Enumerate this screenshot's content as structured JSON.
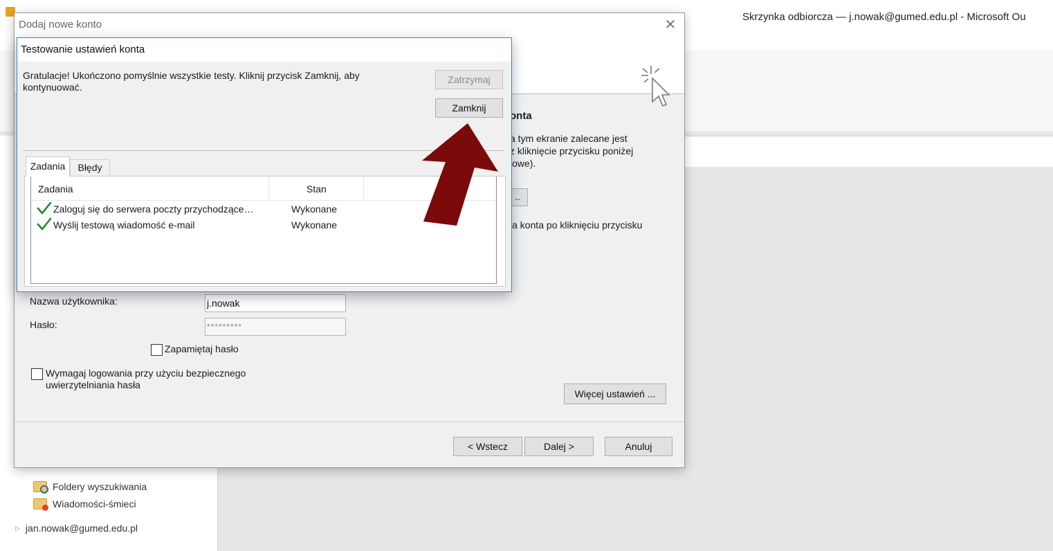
{
  "outlook": {
    "window_title": "Skrzynka odbiorcza — j.nowak@gumed.edu.pl  -  Microsoft Ou",
    "folders": [
      {
        "label": "Foldery wyszukiwania",
        "icon": "search-folder-icon"
      },
      {
        "label": "Wiadomości-śmieci",
        "icon": "junk-folder-icon"
      }
    ],
    "account": "jan.nowak@gumed.edu.pl"
  },
  "add_account_dialog": {
    "title": "Dodaj nowe konto",
    "section_title": "onta",
    "description": "a tym ekranie zalecane jest\nz kliknięcie przycisku poniżej\niowe).",
    "test_button_label": "..",
    "description2": "ia konta po kliknięciu przycisku",
    "username_label": "Nazwa użytkownika:",
    "username_value": "j.nowak",
    "password_label": "Hasło:",
    "password_value": "*********",
    "remember_password_label": "Zapamiętaj hasło",
    "remember_password_checked": false,
    "spa_label": "Wymagaj logowania przy użyciu bezpiecznego uwierzytelniania hasła",
    "spa_checked": false,
    "more_settings_label": "Więcej ustawień ...",
    "back_label": "< Wstecz",
    "next_label": "Dalej >",
    "cancel_label": "Anuluj"
  },
  "test_dialog": {
    "title": "Testowanie ustawień konta",
    "message": "Gratulacje! Ukończono pomyślnie wszystkie testy. Kliknij przycisk Zamknij, aby kontynuować.",
    "stop_label": "Zatrzymaj",
    "close_label": "Zamknij",
    "tabs": [
      "Zadania",
      "Błędy"
    ],
    "columns": [
      "Zadania",
      "Stan"
    ],
    "tasks": [
      {
        "name": "Zaloguj się do serwera poczty przychodzące…",
        "status": "Wykonane"
      },
      {
        "name": "Wyślij testową wiadomość e-mail",
        "status": "Wykonane"
      }
    ]
  },
  "colors": {
    "arrow": "#7b0a0a",
    "check": "#1f8a2e",
    "dialog_border": "#3c7fd6"
  }
}
